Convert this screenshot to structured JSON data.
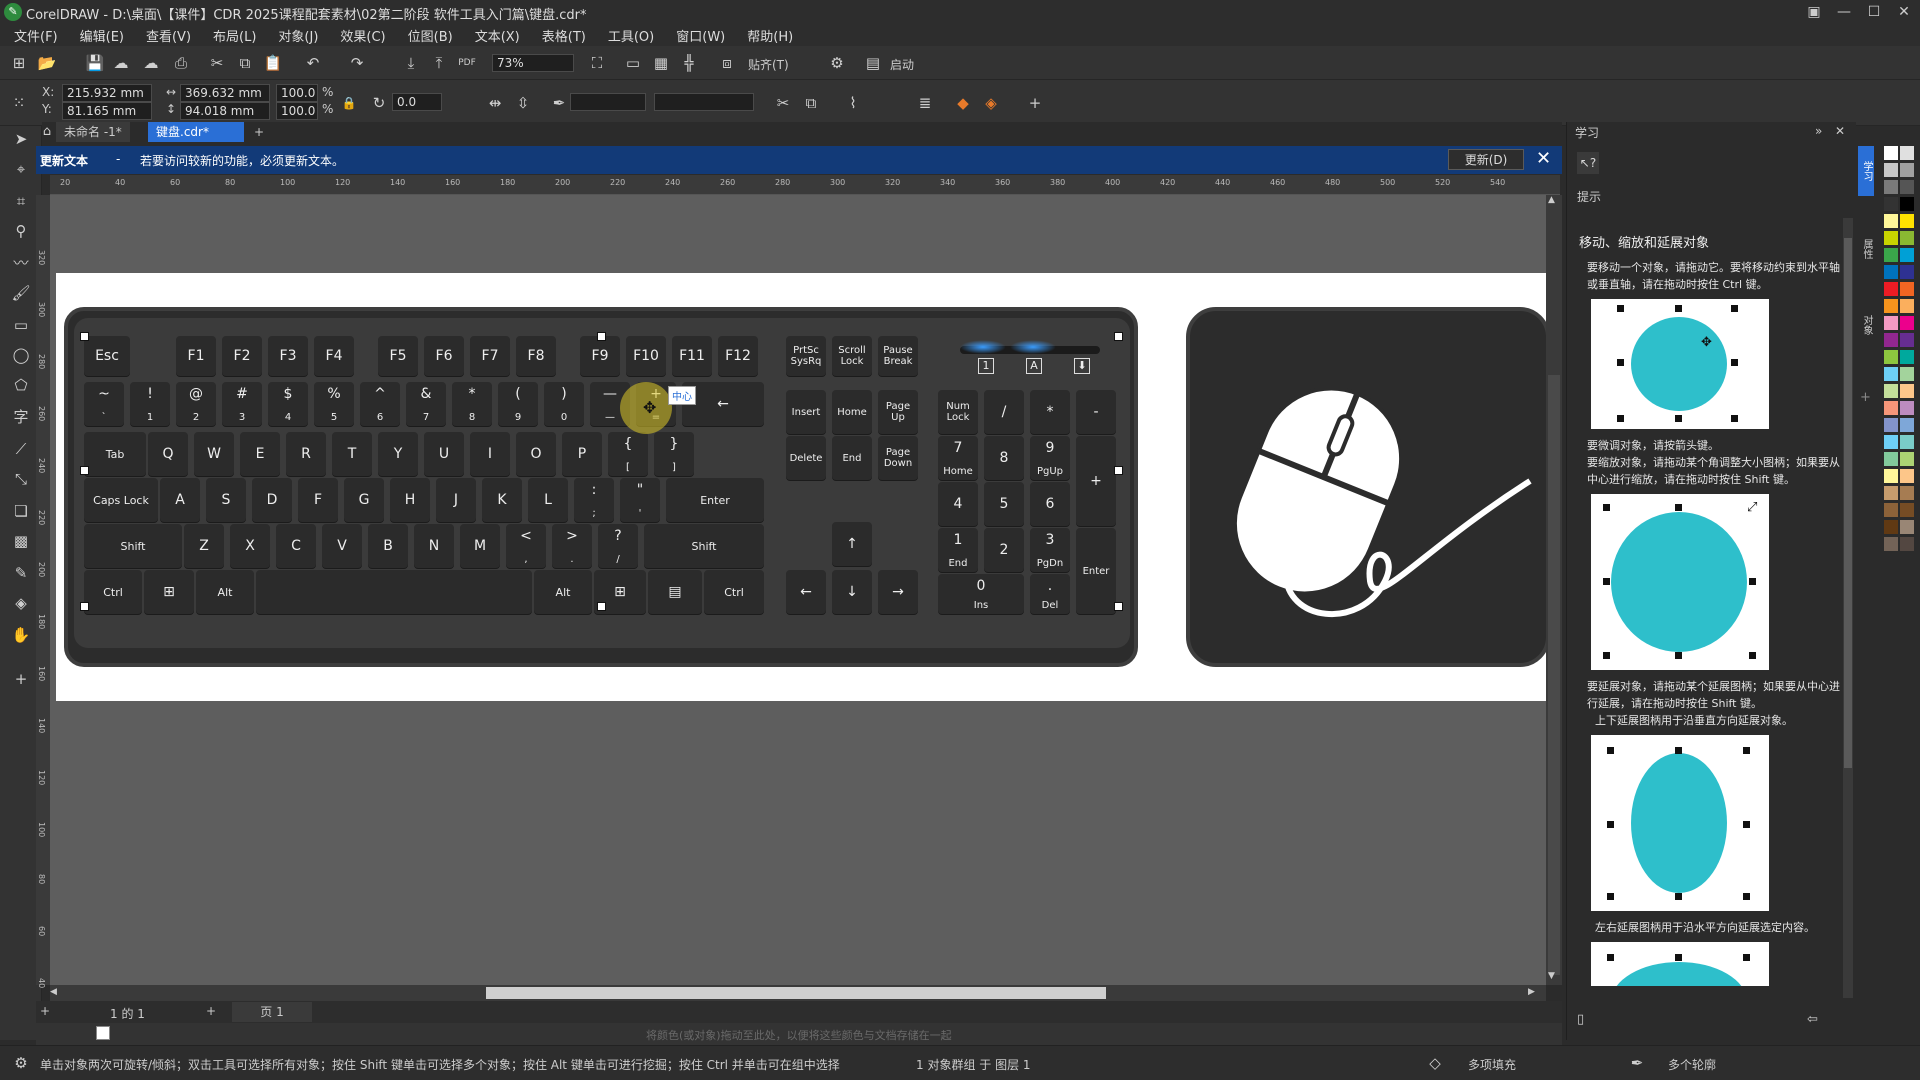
{
  "window": {
    "title": "CorelDRAW - D:\\桌面\\【课件】CDR 2025课程配套素材\\02第二阶段 软件工具入门篇\\键盘.cdr*",
    "app_icon": "coreldraw-logo-icon"
  },
  "menu": [
    "文件(F)",
    "编辑(E)",
    "查看(V)",
    "布局(L)",
    "对象(J)",
    "效果(C)",
    "位图(B)",
    "文本(X)",
    "表格(T)",
    "工具(O)",
    "窗口(W)",
    "帮助(H)"
  ],
  "toolbar": {
    "zoom": "73%",
    "snap_label": "贴齐(T)",
    "launch_label": "启动"
  },
  "property_bar": {
    "x": "215.932 mm",
    "y": "81.165 mm",
    "width": "369.632 mm",
    "height": "94.018 mm",
    "scale_x": "100.0",
    "scale_y": "100.0",
    "percent": "%",
    "rotation": "0.0",
    "x_label": "X:",
    "y_label": "Y:"
  },
  "tabs": [
    "未命名 -1*",
    "键盘.cdr*"
  ],
  "notification": {
    "title": "更新文本",
    "separator": "-",
    "message": "若要访问较新的功能，必须更新文本。",
    "button": "更新(D)"
  },
  "ruler_ticks": [
    "20",
    "40",
    "60",
    "80",
    "100",
    "120",
    "140",
    "160",
    "180",
    "200",
    "220",
    "240",
    "260",
    "280",
    "300",
    "320",
    "340",
    "360",
    "380",
    "400",
    "420",
    "440",
    "460",
    "480",
    "500",
    "520",
    "540"
  ],
  "ruler_v_ticks": [
    "320",
    "300",
    "280",
    "260",
    "240",
    "220",
    "200",
    "180",
    "160",
    "140",
    "120",
    "100",
    "80",
    "60",
    "40"
  ],
  "keyboard": {
    "frow": [
      "Esc",
      "F1",
      "F2",
      "F3",
      "F4",
      "F5",
      "F6",
      "F7",
      "F8",
      "F9",
      "F10",
      "F11",
      "F12"
    ],
    "sys": [
      "PrtSc SysRq",
      "Scroll Lock",
      "Pause Break"
    ],
    "numrow_top": [
      "~",
      "!",
      "@",
      "#",
      "$",
      "%",
      "^",
      "&",
      "*",
      "(",
      ")",
      "—",
      "+"
    ],
    "numrow_bot": [
      "`",
      "1",
      "2",
      "3",
      "4",
      "5",
      "6",
      "7",
      "8",
      "9",
      "0",
      "—",
      "="
    ],
    "qrow": [
      "Tab",
      "Q",
      "W",
      "E",
      "R",
      "T",
      "Y",
      "U",
      "I",
      "O",
      "P"
    ],
    "bracket_top": [
      "{",
      "}",
      "|"
    ],
    "bracket_bot": [
      "[",
      "]",
      "\\"
    ],
    "arow": [
      "Caps Lock",
      "A",
      "S",
      "D",
      "F",
      "G",
      "H",
      "J",
      "K",
      "L"
    ],
    "semi": [
      ":",
      ";"
    ],
    "quote": [
      "\"",
      "'"
    ],
    "enter": "Enter",
    "zrow": [
      "Shift",
      "Z",
      "X",
      "C",
      "V",
      "B",
      "N",
      "M"
    ],
    "lt": [
      "<",
      ","
    ],
    "gt": [
      ">",
      "."
    ],
    "qm": [
      "?",
      "/"
    ],
    "rshift": "Shift",
    "brow": [
      "Ctrl",
      "Alt",
      "Alt",
      "Ctrl"
    ],
    "backspace": "←",
    "nav": [
      "Insert",
      "Home",
      "Page Up",
      "Delete",
      "End",
      "Page Down"
    ],
    "arrows": [
      "↑",
      "←",
      "↓",
      "→"
    ],
    "num": {
      "numlock": "Num Lock",
      "div": "/",
      "mul": "*",
      "minus": "-",
      "plus": "+",
      "enter": "Enter",
      "n7": "7",
      "n7s": "Home",
      "n8": "8",
      "n9": "9",
      "n9s": "PgUp",
      "n4": "4",
      "n5": "5",
      "n6": "6",
      "n1": "1",
      "n1s": "End",
      "n2": "2",
      "n3": "3",
      "n3s": "PgDn",
      "n0": "0",
      "n0s": "Ins",
      "dot": ".",
      "dots": "Del"
    },
    "leds": [
      "1",
      "A",
      "⬇"
    ],
    "center_tooltip": "中心"
  },
  "pagenav": {
    "page_of": "1 的 1",
    "page_tab": "页 1"
  },
  "colorbar_hint": "将颜色(或对象)拖动至此处，以便将这些颜色与文档存储在一起",
  "status": {
    "hint": "单击对象两次可旋转/倾斜；双击工具可选择所有对象；按住 Shift 键单击可选择多个对象；按住 Alt 键单击可进行挖掘；按住 Ctrl 并单击可在组中选择",
    "selection": "1 对象群组 于 图层 1",
    "fill": "多项填充",
    "outline": "多个轮廓"
  },
  "docker": {
    "title": "学习",
    "tip_label": "提示",
    "heading": "移动、缩放和延展对象",
    "b1": "要移动一个对象，请拖动它。要将移动约束到水平轴或垂直轴，请在拖动时按住 Ctrl 键。",
    "b2": "要微调对象，请按箭头键。",
    "b3": "要缩放对象，请拖动某个角调整大小图柄；如果要从中心进行缩放，请在拖动时按住 Shift 键。",
    "b4": "要延展对象，请拖动某个延展图柄；如果要从中心进行延展，请在拖动时按住 Shift 键。",
    "b5": "上下延展图柄用于沿垂直方向延展对象。",
    "b6": "左右延展图柄用于沿水平方向延展选定内容。"
  },
  "vertical_tabs": [
    "学习",
    "属性",
    "对象"
  ],
  "colors": {
    "accent_blue": "#123a78",
    "shape_cyan": "#2ebfcb",
    "tab_active": "#2a6fd6"
  }
}
